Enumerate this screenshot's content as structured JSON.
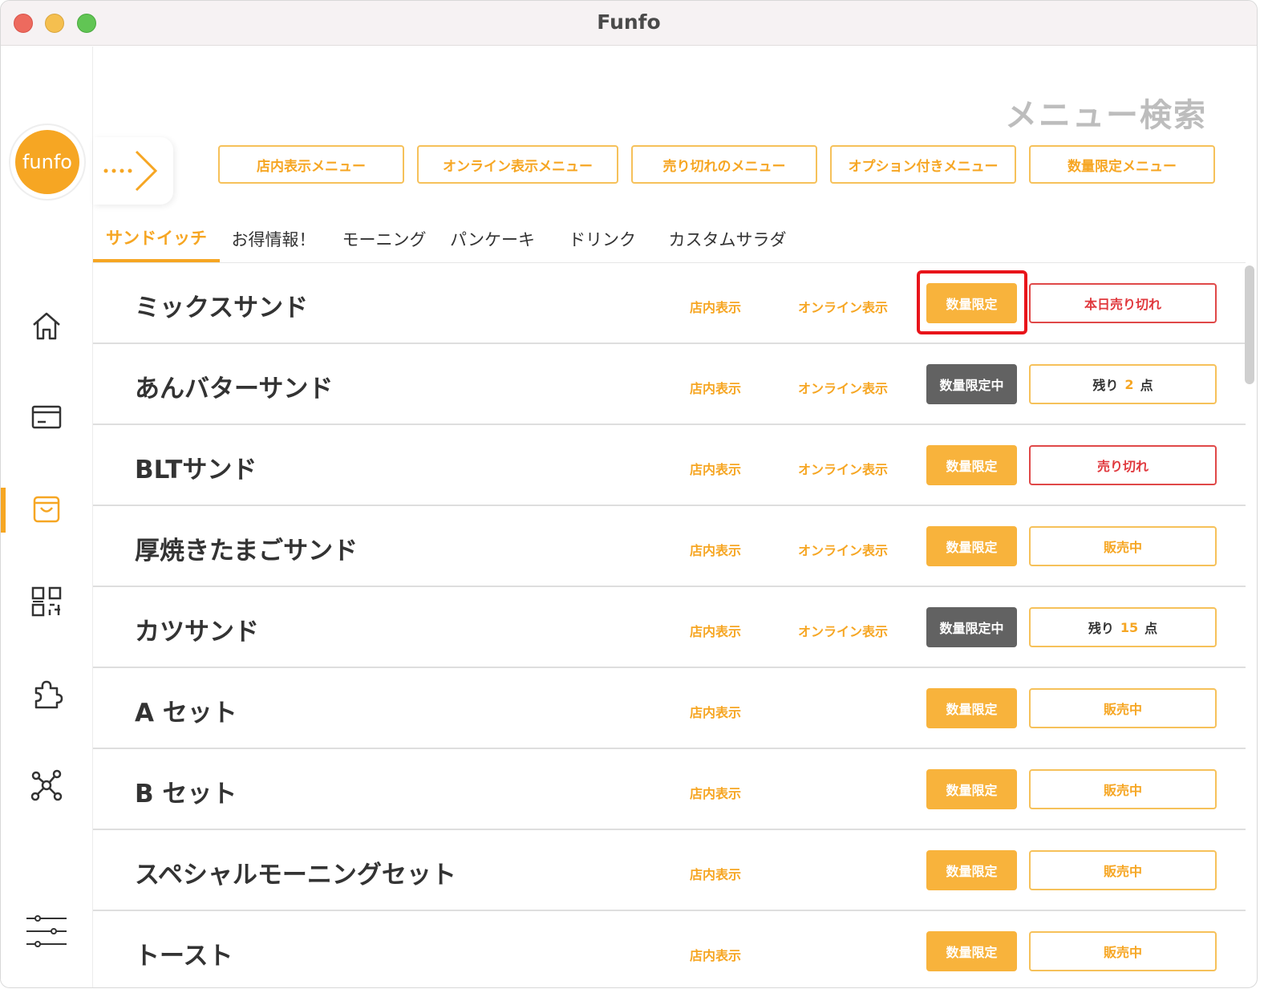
{
  "window": {
    "title": "Funfo"
  },
  "logo": {
    "text": "funfo"
  },
  "header": {
    "search_title": "メニュー検索"
  },
  "filters": [
    "店内表示メニュー",
    "オンライン表示メニュー",
    "売り切れのメニュー",
    "オプション付きメニュー",
    "数量限定メニュー"
  ],
  "tabs": [
    "サンドイッチ",
    "お得情報！",
    "モーニング",
    "パンケーキ",
    "ドリンク",
    "カスタムサラダ"
  ],
  "active_tab": "サンドイッチ",
  "labels": {
    "store": "店内表示",
    "online": "オンライン表示"
  },
  "rows": [
    {
      "name": "ミックスサンド",
      "store": "店内表示",
      "online": "オンライン表示",
      "qty": "数量限定",
      "status": "本日売り切れ"
    },
    {
      "name": "あんバターサンド",
      "store": "店内表示",
      "online": "オンライン表示",
      "qty": "数量限定中",
      "status_prefix": "残り",
      "status_num": "2",
      "status_suffix": "点"
    },
    {
      "name": "BLTサンド",
      "store": "店内表示",
      "online": "オンライン表示",
      "qty": "数量限定",
      "status": "売り切れ"
    },
    {
      "name": "厚焼きたまごサンド",
      "store": "店内表示",
      "online": "オンライン表示",
      "qty": "数量限定",
      "status": "販売中"
    },
    {
      "name": "カツサンド",
      "store": "店内表示",
      "online": "オンライン表示",
      "qty": "数量限定中",
      "status_prefix": "残り",
      "status_num": "15",
      "status_suffix": "点"
    },
    {
      "name": "A セット",
      "store": "店内表示",
      "qty": "数量限定",
      "status": "販売中"
    },
    {
      "name": "B セット",
      "store": "店内表示",
      "qty": "数量限定",
      "status": "販売中"
    },
    {
      "name": "スペシャルモーニングセット",
      "store": "店内表示",
      "qty": "数量限定",
      "status": "販売中"
    },
    {
      "name": "トースト",
      "store": "店内表示",
      "qty": "数量限定",
      "status": "販売中"
    }
  ],
  "colors": {
    "accent": "#f6a623",
    "danger": "#e0393e",
    "gray_badge": "#626262",
    "highlight": "#e8141a"
  },
  "icons": [
    "home-icon",
    "card-icon",
    "shopping-bag-icon",
    "qr-code-icon",
    "puzzle-icon",
    "network-icon",
    "settings-sliders-icon",
    "chevron-right-icon"
  ]
}
